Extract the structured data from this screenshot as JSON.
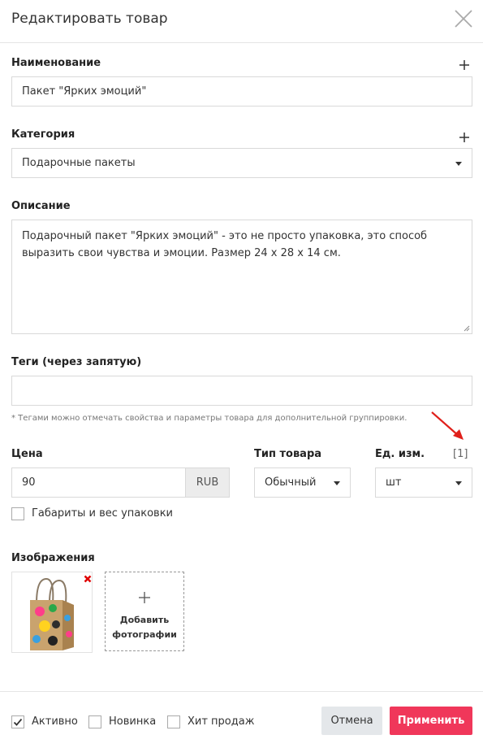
{
  "dialog": {
    "title": "Редактировать товар"
  },
  "name": {
    "label": "Наименование",
    "value": "Пакет \"Ярких эмоций\""
  },
  "category": {
    "label": "Категория",
    "value": "Подарочные пакеты"
  },
  "description": {
    "label": "Описание",
    "line1": "Подарочный пакет \"Ярких эмоций\" - это не просто упаковка, это способ",
    "line2": "выразить свои чувства и эмоции. Размер 24 x 28 x 14 см."
  },
  "tags": {
    "label": "Теги (через запятую)",
    "value": "",
    "hint": "* Тегами можно отмечать свойства и параметры товара для дополнительной группировки."
  },
  "price": {
    "label": "Цена",
    "value": "90",
    "currency": "RUB"
  },
  "product_type": {
    "label": "Тип товара",
    "value": "Обычный"
  },
  "unit": {
    "label": "Ед. изм.",
    "value": "шт",
    "count_badge": "[1]"
  },
  "package": {
    "label": "Габариты и вес упаковки",
    "checked": false
  },
  "images": {
    "label": "Изображения",
    "add_line1": "Добавить",
    "add_line2": "фотографии"
  },
  "footer": {
    "active_label": "Активно",
    "active_checked": true,
    "new_label": "Новинка",
    "new_checked": false,
    "hit_label": "Хит продаж",
    "hit_checked": false,
    "cancel": "Отмена",
    "apply": "Применить"
  },
  "colors": {
    "primary": "#f0375a",
    "annotation": "#e0201b",
    "remove": "#e00000"
  }
}
